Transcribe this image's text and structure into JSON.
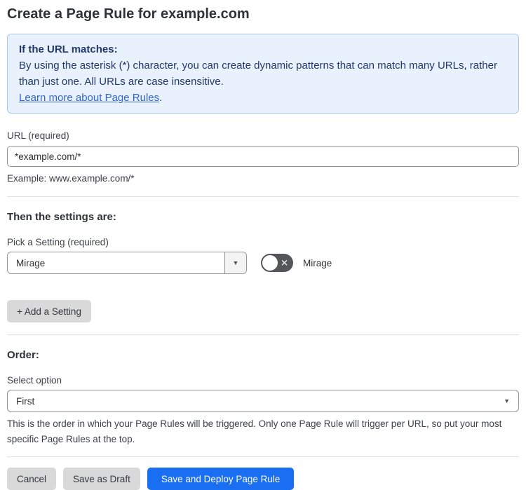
{
  "page": {
    "title": "Create a Page Rule for example.com"
  },
  "info_box": {
    "heading": "If the URL matches:",
    "body": "By using the asterisk (*) character, you can create dynamic patterns that can match many URLs, rather than just one. All URLs are case insensitive.",
    "link_label": "Learn more about Page Rules",
    "link_suffix": "."
  },
  "url_field": {
    "label": "URL (required)",
    "value": "*example.com/*",
    "helper": "Example: www.example.com/*"
  },
  "settings_section": {
    "heading": "Then the settings are:",
    "picker_label": "Pick a Setting (required)",
    "picker_value": "Mirage",
    "toggle_label": "Mirage",
    "toggle_state": "off",
    "add_button_label": "+ Add a Setting"
  },
  "order_section": {
    "heading": "Order:",
    "select_label": "Select option",
    "select_value": "First",
    "helper": "This is the order in which your Page Rules will be triggered. Only one Page Rule will trigger per URL, so put your most specific Page Rules at the top."
  },
  "footer": {
    "cancel_label": "Cancel",
    "save_draft_label": "Save as Draft",
    "save_deploy_label": "Save and Deploy Page Rule"
  },
  "icons": {
    "dropdown_arrow": "▼",
    "toggle_off_x": "✕"
  },
  "colors": {
    "primary_button_blue": "#1a6ef2",
    "info_box_background": "#e9f2fc",
    "info_box_border": "#abc8f0",
    "info_box_text": "#22386b",
    "link_blue": "#3166c9",
    "gray_button_background": "#d9d9d9",
    "toggle_off_background": "#54565a",
    "input_border": "#949494",
    "divider": "#e2e2e2"
  }
}
